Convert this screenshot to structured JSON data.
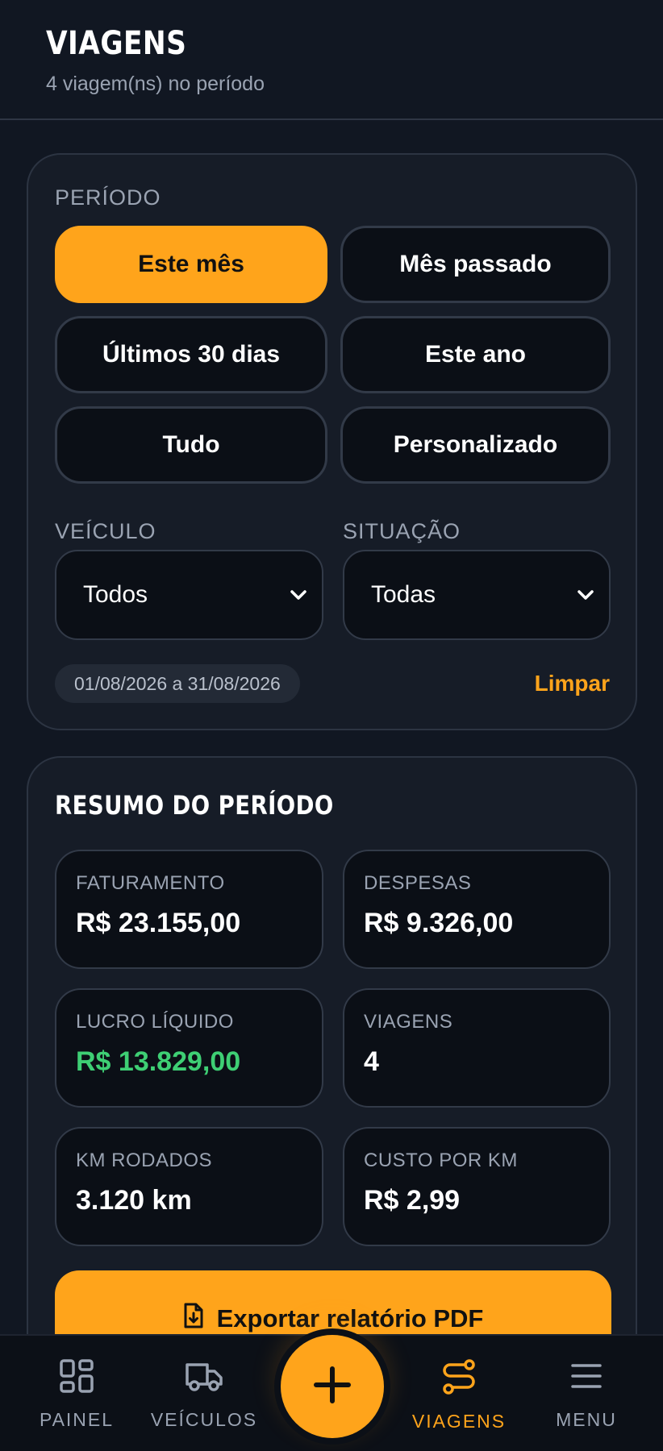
{
  "header": {
    "title": "VIAGENS",
    "subtitle": "4 viagem(ns) no período"
  },
  "filters": {
    "period_label": "PERÍODO",
    "period_options": [
      {
        "label": "Este mês",
        "active": true
      },
      {
        "label": "Mês passado",
        "active": false
      },
      {
        "label": "Últimos 30 dias",
        "active": false
      },
      {
        "label": "Este ano",
        "active": false
      },
      {
        "label": "Tudo",
        "active": false
      },
      {
        "label": "Personalizado",
        "active": false
      }
    ],
    "vehicle_label": "VEÍCULO",
    "vehicle_value": "Todos",
    "status_label": "SITUAÇÃO",
    "status_value": "Todas",
    "date_range": "01/08/2026 a 31/08/2026",
    "clear_label": "Limpar"
  },
  "summary": {
    "title": "RESUMO DO PERÍODO",
    "stats": [
      {
        "label": "FATURAMENTO",
        "value": "R$ 23.155,00"
      },
      {
        "label": "DESPESAS",
        "value": "R$ 9.326,00"
      },
      {
        "label": "LUCRO LÍQUIDO",
        "value": "R$ 13.829,00"
      },
      {
        "label": "VIAGENS",
        "value": "4"
      },
      {
        "label": "KM RODADOS",
        "value": "3.120 km"
      },
      {
        "label": "CUSTO POR KM",
        "value": "R$ 2,99"
      }
    ],
    "export_label": "Exportar relatório PDF"
  },
  "nav": {
    "items": [
      {
        "label": "PAINEL",
        "icon": "dashboard-icon",
        "active": false
      },
      {
        "label": "VEÍCULOS",
        "icon": "truck-icon",
        "active": false
      },
      {
        "label": "VIAGENS",
        "icon": "route-icon",
        "active": true
      },
      {
        "label": "MENU",
        "icon": "menu-icon",
        "active": false
      }
    ],
    "fab_icon": "plus-icon"
  },
  "colors": {
    "accent": "#ffa41b",
    "background": "#111722",
    "card": "#161c27",
    "profit": "#3ecf74"
  }
}
